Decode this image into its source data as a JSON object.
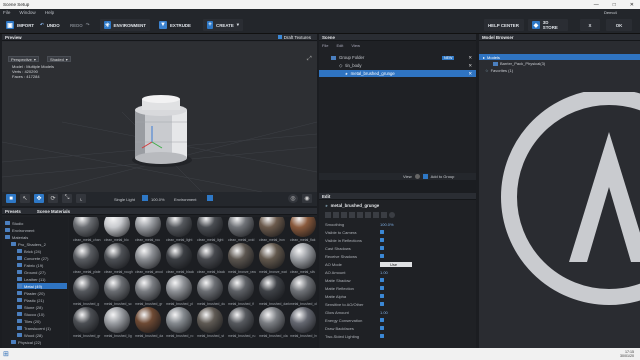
{
  "window": {
    "title": "Scene Setup",
    "controls": [
      "—",
      "□",
      "✕"
    ]
  },
  "menu": [
    "File",
    "Window",
    "Help"
  ],
  "toolbar": {
    "import": "IMPORT",
    "undo": "UNDO",
    "redo": "REDO",
    "environment": "ENVIRONMENT",
    "extrude": "EXTRUDE",
    "create": "CREATE",
    "help_center": "HELP CENTER",
    "store": "3D STORE",
    "close_x": "X",
    "ok": "OK",
    "user": "Demo4"
  },
  "preview": {
    "title": "Preview",
    "draft": "Draft Textures",
    "view_mode": "Perspective",
    "shading": "Shaded",
    "info": [
      "Model : Multiple Models",
      "Verts : 420290",
      "Faces : 417284"
    ],
    "lighting": "Single Light",
    "lighting_value": "100.0%",
    "environment": "Environment"
  },
  "scene": {
    "title": "Scene",
    "menu": [
      "File",
      "Edit",
      "View"
    ],
    "group": "Group Folder",
    "tag": "NEW",
    "object": "tin_body",
    "material": "metal_brushed_grunge",
    "view_label": "View",
    "add_group": "Add to Group"
  },
  "edit": {
    "title": "Edit",
    "material_name": "metal_brushed_grunge",
    "props": [
      {
        "label": "Smoothing",
        "value": "100.0%"
      },
      {
        "label": "Visible to Camera",
        "value": ""
      },
      {
        "label": "Visible in Reflections",
        "value": ""
      },
      {
        "label": "Cast Shadows",
        "value": ""
      },
      {
        "label": "Receive Shadows",
        "value": ""
      },
      {
        "label": "AO Mode",
        "value": "Use"
      },
      {
        "label": "AO Amount",
        "value": "1.00"
      },
      {
        "label": "Matte Shadow",
        "value": ""
      },
      {
        "label": "Matte Reflection",
        "value": ""
      },
      {
        "label": "Matte Alpha",
        "value": ""
      },
      {
        "label": "Sensitive to AO/Other",
        "value": ""
      },
      {
        "label": "Glow Amount",
        "value": "1.00"
      },
      {
        "label": "Energy Conservation",
        "value": ""
      },
      {
        "label": "Draw Backfaces",
        "value": ""
      },
      {
        "label": "Two-Sided Lighting",
        "value": ""
      }
    ]
  },
  "model_browser": {
    "title": "Model Browser",
    "root": "Models",
    "item": "Barrier_Pack_Physical(3)",
    "favorites": "Favorites (1)"
  },
  "presets": {
    "tabs": [
      "Presets",
      "Scene Materials"
    ],
    "tree": [
      {
        "label": "Studio",
        "indent": 0
      },
      {
        "label": "Environment",
        "indent": 0
      },
      {
        "label": "Materials",
        "indent": 0
      },
      {
        "label": "Pro_Shaders_2",
        "indent": 1
      },
      {
        "label": "Brick (24)",
        "indent": 2
      },
      {
        "label": "Concrete (27)",
        "indent": 2
      },
      {
        "label": "Fabric (19)",
        "indent": 2
      },
      {
        "label": "Ground (27)",
        "indent": 2
      },
      {
        "label": "Leather (11)",
        "indent": 2
      },
      {
        "label": "Metal (49)",
        "indent": 2,
        "selected": true
      },
      {
        "label": "Plaster (20)",
        "indent": 2
      },
      {
        "label": "Plastic (21)",
        "indent": 2
      },
      {
        "label": "Stone (28)",
        "indent": 2
      },
      {
        "label": "Stucco (10)",
        "indent": 2
      },
      {
        "label": "Tiles (20)",
        "indent": 2
      },
      {
        "label": "Translucent (1)",
        "indent": 2
      },
      {
        "label": "Wood (28)",
        "indent": 2
      },
      {
        "label": "Physical (22)",
        "indent": 1
      }
    ],
    "labels": [
      [
        "clean_metal_chan",
        "clean_metal_blo",
        "clean_metal_rou",
        "clean_metal_light",
        "clean_metal_light",
        "clean_metal_oxid",
        "clean_metal_iron",
        "clean_metal_flak"
      ],
      [
        "clean_metal_plate",
        "clean_metal_rough",
        "clean_metal_anod",
        "clean_metal_black",
        "clean_metal_black",
        "metal_bronze_raw",
        "metal_bronze_wat",
        "clean_metal_silv"
      ],
      [
        "metal_brushed_g",
        "metal_brushed_sc",
        "metal_brushed_gr",
        "metal_brushed_pl",
        "metal_brushed_du",
        "metal_brushed_fi",
        "metal_brushed_dark",
        "metal_brushed_old"
      ],
      [
        "metal_brushed_gr",
        "metal_brushed_lig",
        "metal_brushed_da",
        "metal_brushed_ro",
        "metal_brushed_st",
        "metal_brushed_ru",
        "metal_brushed_cla",
        "metal_brushed_hv"
      ]
    ]
  },
  "taskbar": {
    "time": "17:15",
    "date": "30/01/20"
  }
}
